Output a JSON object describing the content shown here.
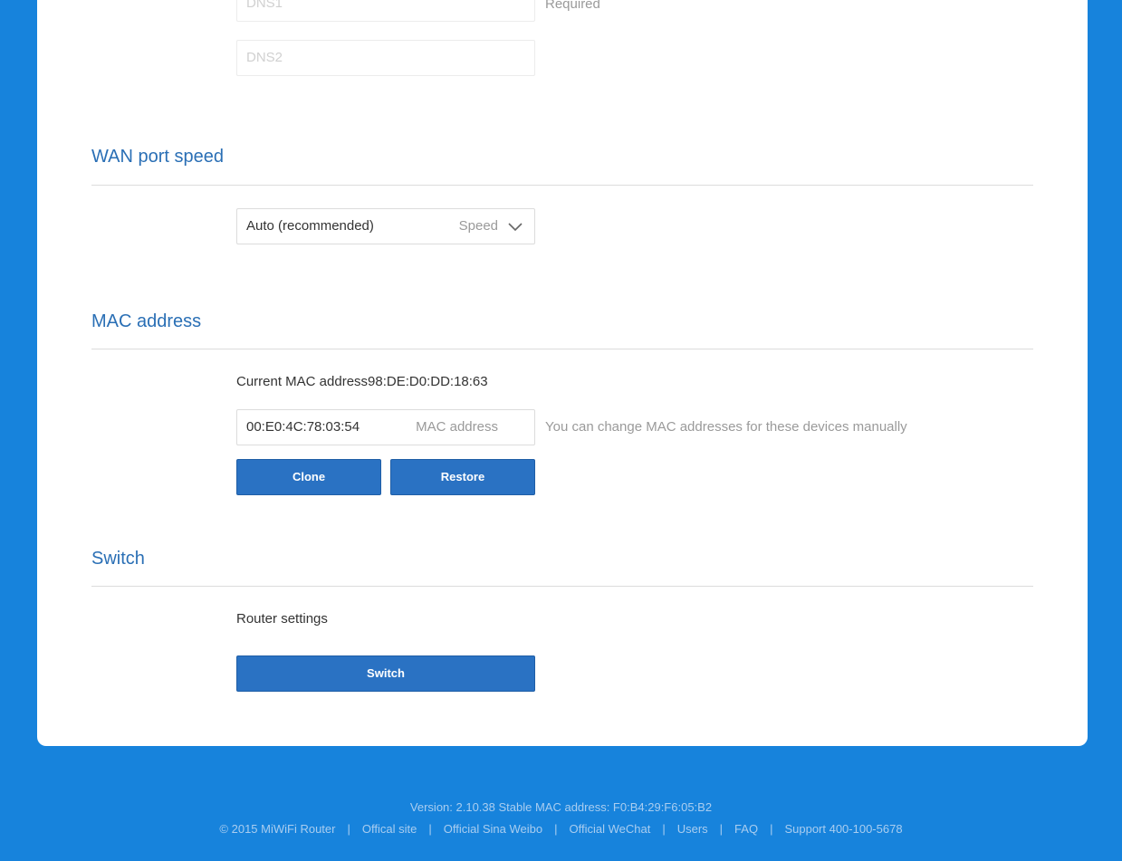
{
  "dns": {
    "dns1_placeholder": "DNS1",
    "dns1_hint": "Required",
    "dns2_placeholder": "DNS2"
  },
  "wan_speed": {
    "title": "WAN port speed",
    "selected_value": "Auto (recommended)",
    "field_label": "Speed"
  },
  "mac": {
    "title": "MAC address",
    "current_label": "Current MAC address98:DE:D0:DD:18:63",
    "input_value": "00:E0:4C:78:03:54",
    "field_label": "MAC address",
    "hint": "You can change MAC addresses for these devices manually",
    "clone_label": "Clone",
    "restore_label": "Restore"
  },
  "switch": {
    "title": "Switch",
    "description": "Router settings",
    "button_label": "Switch"
  },
  "footer": {
    "version_line": "Version: 2.10.38 Stable  MAC address: F0:B4:29:F6:05:B2",
    "links": [
      "© 2015 MiWiFi Router",
      "Offical site",
      "Official Sina Weibo",
      "Official WeChat",
      "Users",
      "FAQ",
      "Support 400-100-5678"
    ]
  },
  "colors": {
    "background": "#1783dc",
    "accent": "#2a72c3",
    "section_title": "#2a6fb5"
  },
  "icons": {
    "speed_dropdown": "chevron-down-icon"
  }
}
